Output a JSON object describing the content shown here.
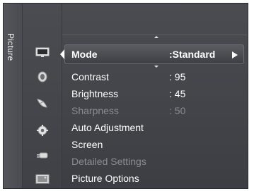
{
  "side_tab": {
    "label": "Picture"
  },
  "icons": [
    "picture-tv-icon",
    "sound-speaker-icon",
    "channel-dish-icon",
    "setup-gear-icon",
    "input-plug-icon",
    "application-card-icon"
  ],
  "menu": {
    "selected": {
      "label": "Mode",
      "value": ":Standard"
    },
    "items": [
      {
        "label": "Contrast",
        "value": ": 95",
        "enabled": true
      },
      {
        "label": "Brightness",
        "value": ": 45",
        "enabled": true
      },
      {
        "label": "Sharpness",
        "value": ": 50",
        "enabled": false
      },
      {
        "label": "Auto Adjustment",
        "value": "",
        "enabled": true
      },
      {
        "label": "Screen",
        "value": "",
        "enabled": true
      },
      {
        "label": "Detailed Settings",
        "value": "",
        "enabled": false
      },
      {
        "label": "Picture Options",
        "value": "",
        "enabled": true
      }
    ]
  },
  "colors": {
    "panel": "#45474c",
    "text": "#ffffff",
    "disabled_text": "#8a8c92"
  }
}
